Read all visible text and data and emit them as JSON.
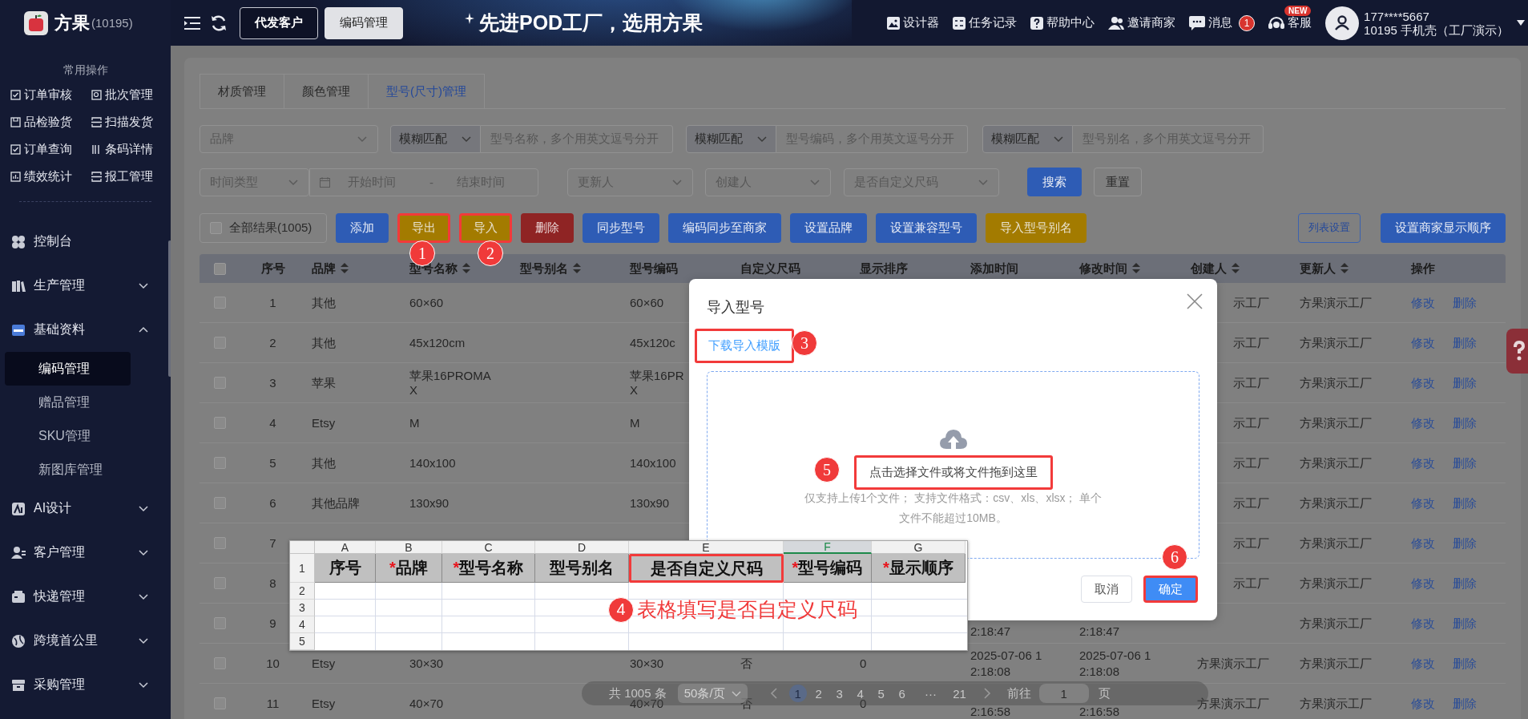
{
  "header": {
    "brand": "方果",
    "brand_code": "(10195)",
    "nav_buttons": [
      {
        "label": "代发客户",
        "selected": false
      },
      {
        "label": "编码管理",
        "selected": true
      }
    ],
    "slogan": "先进POD工厂，选用方果",
    "links": [
      {
        "label": "设计器"
      },
      {
        "label": "任务记录"
      },
      {
        "label": "帮助中心"
      },
      {
        "label": "邀请商家"
      },
      {
        "label": "消息",
        "badge": "1"
      },
      {
        "label": "客服",
        "tag": "NEW"
      }
    ],
    "user": {
      "phone": "177****5667",
      "account": "10195  手机壳（工厂演示）"
    }
  },
  "sidebar": {
    "section_title": "常用操作",
    "shortcuts": [
      "订单审核",
      "批次管理",
      "品检验货",
      "扫描发货",
      "订单查询",
      "条码详情",
      "绩效统计",
      "报工管理"
    ],
    "menu": [
      {
        "label": "控制台"
      },
      {
        "label": "生产管理",
        "expanded": false
      },
      {
        "label": "基础资料",
        "expanded": true,
        "children": [
          {
            "label": "编码管理",
            "selected": true
          },
          {
            "label": "赠品管理",
            "selected": false
          },
          {
            "label": "SKU管理",
            "selected": false
          },
          {
            "label": "新图库管理",
            "selected": false
          }
        ]
      },
      {
        "label": "AI设计",
        "expanded": false
      },
      {
        "label": "客户管理",
        "expanded": false
      },
      {
        "label": "快递管理",
        "expanded": false
      },
      {
        "label": "跨境首公里",
        "expanded": false
      },
      {
        "label": "采购管理",
        "expanded": false
      }
    ]
  },
  "tabs": [
    {
      "label": "材质管理",
      "selected": false
    },
    {
      "label": "颜色管理",
      "selected": false
    },
    {
      "label": "型号(尺寸)管理",
      "selected": true
    }
  ],
  "filters": [
    [
      {
        "kind": "select",
        "placeholder": "品牌"
      },
      {
        "kind": "match",
        "mode": "模糊匹配",
        "placeholder": "型号名称，多个用英文逗号分开"
      },
      {
        "kind": "match",
        "mode": "模糊匹配",
        "placeholder": "型号编码，多个用英文逗号分开"
      },
      {
        "kind": "match",
        "mode": "模糊匹配",
        "placeholder": "型号别名，多个用英文逗号分开"
      }
    ],
    [
      {
        "kind": "select",
        "placeholder": "时间类型"
      },
      {
        "kind": "daterange",
        "start_placeholder": "开始时间",
        "separator": "-",
        "end_placeholder": "结束时间"
      },
      {
        "kind": "select",
        "placeholder": "更新人"
      },
      {
        "kind": "select",
        "placeholder": "创建人"
      },
      {
        "kind": "select",
        "placeholder": "是否自定义尺码"
      },
      {
        "kind": "button",
        "label": "搜索"
      },
      {
        "kind": "button",
        "label": "重置"
      }
    ]
  ],
  "toolbar": {
    "select_all": {
      "label": "全部结果(1005)",
      "checked": false
    },
    "buttons": [
      {
        "label": "添加",
        "highlighted": false
      },
      {
        "label": "导出",
        "highlighted": true
      },
      {
        "label": "导入",
        "highlighted": true
      },
      {
        "label": "删除",
        "highlighted": false
      },
      {
        "label": "同步型号",
        "highlighted": false
      },
      {
        "label": "编码同步至商家",
        "highlighted": false
      },
      {
        "label": "设置品牌",
        "highlighted": false
      },
      {
        "label": "设置兼容型号",
        "highlighted": false
      },
      {
        "label": "导入型号别名",
        "highlighted": false
      }
    ],
    "right_buttons": [
      {
        "label": "列表设置"
      },
      {
        "label": "设置商家显示顺序"
      }
    ]
  },
  "table": {
    "select_all_checked": false,
    "columns": [
      {
        "label": "序号",
        "sortable": false
      },
      {
        "label": "品牌",
        "sortable": true
      },
      {
        "label": "型号名称",
        "sortable": true
      },
      {
        "label": "型号别名",
        "sortable": true
      },
      {
        "label": "型号编码",
        "sortable": false
      },
      {
        "label": "自定义尺码",
        "sortable": false
      },
      {
        "label": "显示排序",
        "sortable": false
      },
      {
        "label": "添加时间",
        "sortable": false
      },
      {
        "label": "修改时间",
        "sortable": true
      },
      {
        "label": "创建人",
        "sortable": true
      },
      {
        "label": "更新人",
        "sortable": true
      },
      {
        "label": "操作",
        "sortable": false
      }
    ],
    "rows": [
      {
        "checked": false,
        "index": "1",
        "brand": "其他",
        "model_name": "60×60",
        "model_code": "60×60",
        "creator": "示工厂",
        "updater": "方果演示工厂",
        "actions": [
          "修改",
          "删除"
        ]
      },
      {
        "checked": false,
        "index": "2",
        "brand": "其他",
        "model_name": "45x120cm",
        "model_code": "45x120c",
        "creator": "示工厂",
        "updater": "方果演示工厂",
        "actions": [
          "修改",
          "删除"
        ]
      },
      {
        "checked": false,
        "index": "3",
        "brand": "苹果",
        "model_name": "苹果16PROMA\nX",
        "model_code": "苹果16PR\nX",
        "creator": "示工厂",
        "updater": "方果演示工厂",
        "actions": [
          "修改",
          "删除"
        ]
      },
      {
        "checked": false,
        "index": "4",
        "brand": "Etsy",
        "model_name": "M",
        "model_code": "M",
        "creator": "示工厂",
        "updater": "方果演示工厂",
        "actions": [
          "修改",
          "删除"
        ]
      },
      {
        "checked": false,
        "index": "5",
        "brand": "其他",
        "model_name": "140x100",
        "model_code": "140x100",
        "creator": "示工厂",
        "updater": "方果演示工厂",
        "actions": [
          "修改",
          "删除"
        ]
      },
      {
        "checked": false,
        "index": "6",
        "brand": "其他品牌",
        "model_name": "130x90",
        "model_code": "130x90",
        "creator": "示工厂",
        "updater": "方果演示工厂",
        "actions": [
          "修改",
          "删除"
        ]
      },
      {
        "checked": false,
        "index": "7",
        "creator": "示工厂",
        "updater": "方果演示工厂",
        "actions": [
          "修改",
          "删除"
        ]
      },
      {
        "checked": false,
        "index": "8",
        "creator": "示工厂",
        "updater": "方果演示工厂",
        "actions": [
          "修改",
          "删除"
        ]
      },
      {
        "checked": false,
        "index": "9",
        "created": "2:18:47",
        "modified": "2:18:47",
        "updater": "方果演示工厂",
        "actions": [
          "修改",
          "删除"
        ]
      },
      {
        "checked": false,
        "index": "10",
        "brand": "Etsy",
        "model_name": "30×30",
        "model_code": "30×30",
        "custom_size": "否",
        "sort_order": "0",
        "created": "2025-07-06 1\n2:18:08",
        "modified": "2025-07-06 1\n2:18:08",
        "creator": "方果演示工厂",
        "updater": "方果演示工厂",
        "actions": [
          "修改",
          "删除"
        ]
      },
      {
        "checked": false,
        "index": "11",
        "brand": "Etsy",
        "model_name": "40×70",
        "model_code": "40×70",
        "custom_size": "否",
        "sort_order": "0",
        "created": "2:16:58",
        "modified": "2:16:58",
        "creator": "方果演示工厂",
        "updater": "方果演示工厂",
        "actions": [
          "修改",
          "删除"
        ]
      }
    ]
  },
  "pagination": {
    "total": "共 1005 条",
    "page_size": "50条/页",
    "pages": [
      {
        "label": "1",
        "selected": true
      },
      {
        "label": "2",
        "selected": false
      },
      {
        "label": "3",
        "selected": false
      },
      {
        "label": "4",
        "selected": false
      },
      {
        "label": "5",
        "selected": false
      },
      {
        "label": "6",
        "selected": false
      },
      {
        "label": "···",
        "selected": false
      },
      {
        "label": "21",
        "selected": false
      }
    ],
    "goto_label": "前往",
    "goto_value": "1",
    "goto_suffix": "页"
  },
  "dialog": {
    "title": "导入型号",
    "template_link": {
      "label": "下载导入模版",
      "highlighted": true
    },
    "upload": {
      "prompt": "点击选择文件或将文件拖到这里",
      "highlighted": true,
      "hint": "仅支持上传1个文件； 支持文件格式：csv、xls、xlsx； 单个文件不能超过10MB。"
    },
    "buttons": [
      {
        "label": "取消",
        "highlighted": false
      },
      {
        "label": "确定",
        "highlighted": true
      }
    ]
  },
  "spreadsheet": {
    "columns": [
      {
        "letter": "A",
        "selected": false
      },
      {
        "letter": "B",
        "selected": false
      },
      {
        "letter": "C",
        "selected": false
      },
      {
        "letter": "D",
        "selected": false
      },
      {
        "letter": "E",
        "selected": false
      },
      {
        "letter": "F",
        "selected": true
      },
      {
        "letter": "G",
        "selected": false
      }
    ],
    "header_cells": [
      {
        "label": "序号",
        "highlighted": false
      },
      {
        "mark": "*",
        "label": "品牌",
        "highlighted": false
      },
      {
        "mark": "*",
        "label": "型号名称",
        "highlighted": false
      },
      {
        "label": "型号别名",
        "highlighted": false
      },
      {
        "label": "是否自定义尺码",
        "highlighted": true
      },
      {
        "mark": "*",
        "label": "型号编码",
        "highlighted": false
      },
      {
        "mark": "*",
        "label": "显示顺序",
        "highlighted": false
      }
    ],
    "row_numbers": [
      "1",
      "2",
      "3",
      "4",
      "5"
    ]
  },
  "annotations": [
    {
      "number": "1"
    },
    {
      "number": "2"
    },
    {
      "number": "3"
    },
    {
      "number": "4",
      "note": "表格填写是否自定义尺码"
    },
    {
      "number": "5"
    },
    {
      "number": "6"
    }
  ]
}
